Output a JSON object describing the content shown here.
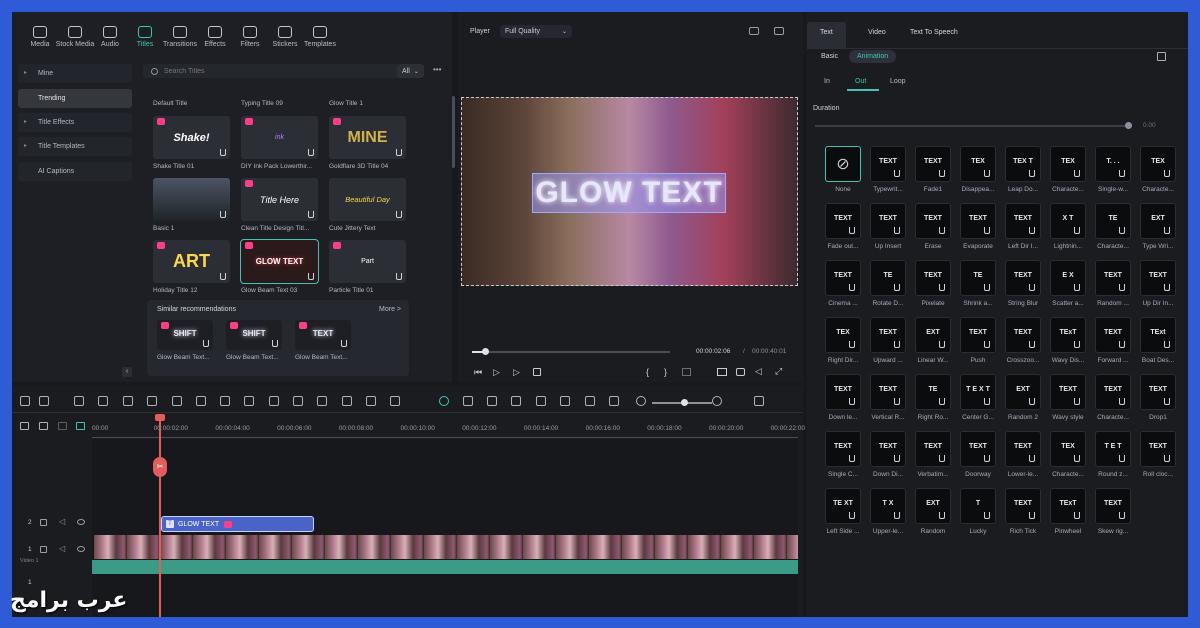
{
  "media_toolbar": [
    {
      "label": "Media"
    },
    {
      "label": "Stock Media"
    },
    {
      "label": "Audio"
    },
    {
      "label": "Titles"
    },
    {
      "label": "Transitions"
    },
    {
      "label": "Effects"
    },
    {
      "label": "Filters"
    },
    {
      "label": "Stickers"
    },
    {
      "label": "Templates"
    }
  ],
  "left_nav": [
    "Mine",
    "Trending",
    "Title Effects",
    "Title Templates",
    "AI Captions"
  ],
  "search": {
    "placeholder": "Search Titles",
    "filter": "All"
  },
  "titles": [
    {
      "name": "Default Title"
    },
    {
      "name": "Typing Title 09"
    },
    {
      "name": "Glow Title 1"
    },
    {
      "name": "Shake Title 01",
      "art": "Shake!"
    },
    {
      "name": "DIY Ink Pack Lowerthir...",
      "art": "ink"
    },
    {
      "name": "Goldflare 3D Title 04",
      "art": "MINE"
    },
    {
      "name": "Basic 1",
      "art": ""
    },
    {
      "name": "Clean Title Design Titl...",
      "art": "Title Here"
    },
    {
      "name": "Cute Jittery Text",
      "art": "Beautiful Day"
    },
    {
      "name": "Holiday Title 12",
      "art": "ART"
    },
    {
      "name": "Glow Beam Text 03",
      "art": "GLOW TEXT"
    },
    {
      "name": "Particle Title 01",
      "art": "Part"
    }
  ],
  "similar": {
    "title": "Similar recommendations",
    "more": "More >",
    "items": [
      {
        "name": "Glow Beam Text...",
        "art": "SHIFT"
      },
      {
        "name": "Glow Beam Text...",
        "art": "SHIFT"
      },
      {
        "name": "Glow Beam Text...",
        "art": "TEXT"
      }
    ]
  },
  "player": {
    "label": "Player",
    "quality": "Full Quality",
    "overlay_text": "GLOW TEXT",
    "time_current": "00:00:02:06",
    "time_separator": "/",
    "time_total": "00:00:40:01"
  },
  "right_panel": {
    "tabs": [
      "Text",
      "Video",
      "Text To Speech"
    ],
    "subtabs": [
      "Basic",
      "Animation"
    ],
    "anim_tabs": [
      "In",
      "Out",
      "Loop"
    ],
    "duration_label": "Duration",
    "duration_value": "0.00",
    "effects": [
      {
        "label": "None",
        "glyph": "⊘"
      },
      {
        "label": "Typewrit...",
        "glyph": "TEXT"
      },
      {
        "label": "Fade1",
        "glyph": "TEXT"
      },
      {
        "label": "Disappea...",
        "glyph": "TEX"
      },
      {
        "label": "Leap Do...",
        "glyph": "TEX T"
      },
      {
        "label": "Characte...",
        "glyph": "TEX"
      },
      {
        "label": "Single-w...",
        "glyph": "T. . ."
      },
      {
        "label": "Characte...",
        "glyph": "TEX"
      },
      {
        "label": "Fade out...",
        "glyph": "TEXT"
      },
      {
        "label": "Up Insert",
        "glyph": "TEXT"
      },
      {
        "label": "Erase",
        "glyph": "TEXT"
      },
      {
        "label": "Evaporate",
        "glyph": "TEXT"
      },
      {
        "label": "Left Dir I...",
        "glyph": "TEXT"
      },
      {
        "label": "Lightnin...",
        "glyph": "X T"
      },
      {
        "label": "Characte...",
        "glyph": "TE"
      },
      {
        "label": "Type Wri...",
        "glyph": "EXT"
      },
      {
        "label": "Cinema ...",
        "glyph": "TEXT"
      },
      {
        "label": "Rotate D...",
        "glyph": "TE"
      },
      {
        "label": "Pixelate",
        "glyph": "TEXT"
      },
      {
        "label": "Shrink a...",
        "glyph": "TE"
      },
      {
        "label": "String Blur",
        "glyph": "TEXT"
      },
      {
        "label": "Scatter a...",
        "glyph": "E X"
      },
      {
        "label": "Random ...",
        "glyph": "TEXT"
      },
      {
        "label": "Up Dir In...",
        "glyph": "TEXT"
      },
      {
        "label": "Right Dir...",
        "glyph": "TEX"
      },
      {
        "label": "Upward ...",
        "glyph": "TEXT"
      },
      {
        "label": "Linear W...",
        "glyph": "EXT"
      },
      {
        "label": "Push",
        "glyph": "TEXT"
      },
      {
        "label": "Crosszoo...",
        "glyph": "TEXT"
      },
      {
        "label": "Wavy Dis...",
        "glyph": "TExT"
      },
      {
        "label": "Forward ...",
        "glyph": "TEXT"
      },
      {
        "label": "Boat Des...",
        "glyph": "TExt"
      },
      {
        "label": "Down le...",
        "glyph": "TEXT"
      },
      {
        "label": "Vertical R...",
        "glyph": "TEXT"
      },
      {
        "label": "Right Ro...",
        "glyph": "TE"
      },
      {
        "label": "Center G...",
        "glyph": "T E X T"
      },
      {
        "label": "Random 2",
        "glyph": "EXT"
      },
      {
        "label": "Wavy style",
        "glyph": "TEXT"
      },
      {
        "label": "Characte...",
        "glyph": "TEXT"
      },
      {
        "label": "Drop1",
        "glyph": "TEXT"
      },
      {
        "label": "Single C...",
        "glyph": "TEXT"
      },
      {
        "label": "Down Di...",
        "glyph": "TEXT"
      },
      {
        "label": "Verbatim...",
        "glyph": "TEXT"
      },
      {
        "label": "Doorway",
        "glyph": "TEXT"
      },
      {
        "label": "Lower-le...",
        "glyph": "TEXT"
      },
      {
        "label": "Characte...",
        "glyph": "TEX"
      },
      {
        "label": "Round z...",
        "glyph": "T E T"
      },
      {
        "label": "Roll cloc...",
        "glyph": "TEXT"
      },
      {
        "label": "Left Side ...",
        "glyph": "TE XT"
      },
      {
        "label": "Upper-le...",
        "glyph": "T X"
      },
      {
        "label": "Random",
        "glyph": "EXT"
      },
      {
        "label": "Lucky",
        "glyph": "T"
      },
      {
        "label": "Rich Tick",
        "glyph": "TEXT"
      },
      {
        "label": "Pinwheel",
        "glyph": "TExT"
      },
      {
        "label": "Skew rig...",
        "glyph": "TEXT"
      }
    ]
  },
  "timeline": {
    "ruler": [
      "00:00",
      "00:00:02:00",
      "00:00:04:00",
      "00:00:06:00",
      "00:00:08:00",
      "00:00:10:00",
      "00:00:12:00",
      "00:00:14:00",
      "00:00:16:00",
      "00:00:18:00",
      "00:00:20:00",
      "00:00:22:00"
    ],
    "title_clip": "GLOW TEXT",
    "track_video_label": "Video 1",
    "track_numbers": [
      "2",
      "1",
      "1"
    ]
  },
  "watermark": "عرب برامج",
  "colors": {
    "accent": "#3ec6b4",
    "clip": "#4a63c9",
    "audio": "#3c9b86",
    "playhead": "#e35b5b"
  }
}
